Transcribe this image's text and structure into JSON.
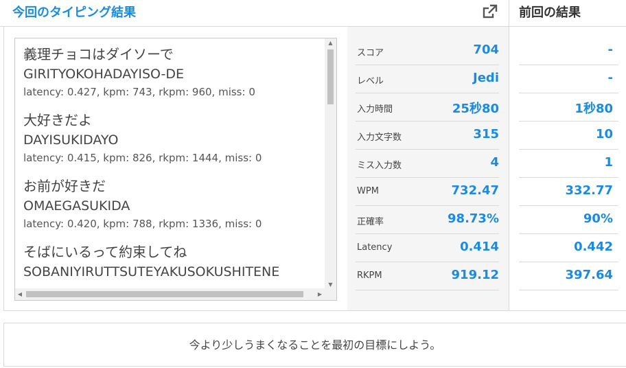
{
  "header": {
    "title": "今回のタイピング結果",
    "prev_title": "前回の結果",
    "external_icon": "external-link-icon"
  },
  "entries": [
    {
      "jp": "義理チョコはダイソーで",
      "romaji": "GIRITYOKOHADAYISO-DE",
      "stats": "latency: 0.427, kpm: 743, rkpm: 960, miss: 0"
    },
    {
      "jp": "大好きだよ",
      "romaji": "DAYISUKIDAYO",
      "stats": "latency: 0.415, kpm: 826, rkpm: 1444, miss: 0"
    },
    {
      "jp": "お前が好きだ",
      "romaji": "OMAEGASUKIDA",
      "stats": "latency: 0.420, kpm: 788, rkpm: 1336, miss: 0"
    },
    {
      "jp": "そばにいるって約束してね",
      "romaji": "SOBANIYIRUTTSUTEYAKUSOKUSHITENE",
      "stats": ""
    }
  ],
  "stats": [
    {
      "label": "スコア",
      "value": "704",
      "prev": "-"
    },
    {
      "label": "レベル",
      "value": "Jedi",
      "prev": "-"
    },
    {
      "label": "入力時間",
      "value": "25秒80",
      "prev": "1秒80"
    },
    {
      "label": "入力文字数",
      "value": "315",
      "prev": "10"
    },
    {
      "label": "ミス入力数",
      "value": "4",
      "prev": "1"
    },
    {
      "label": "WPM",
      "value": "732.47",
      "prev": "332.77"
    },
    {
      "label": "正確率",
      "value": "98.73%",
      "prev": "90%"
    },
    {
      "label": "Latency",
      "value": "0.414",
      "prev": "0.442"
    },
    {
      "label": "RKPM",
      "value": "919.12",
      "prev": "397.64"
    }
  ],
  "message": "今より少しうまくなることを最初の目標にしよう。",
  "colors": {
    "accent": "#1a8be0",
    "panel_bg": "#f5f5f5",
    "border": "#d9d9d9"
  }
}
